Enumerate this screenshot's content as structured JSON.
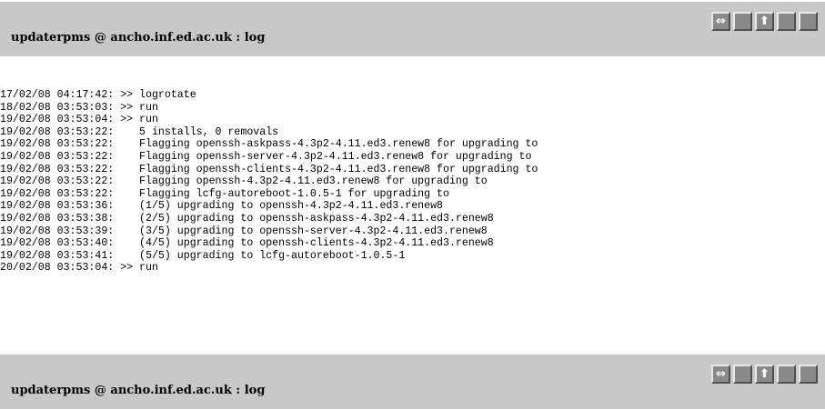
{
  "header": {
    "title": "updaterpms @ ancho.inf.ed.ac.uk : log"
  },
  "nav_buttons": [
    {
      "name": "double-arrow-icon",
      "glyph": "⇔"
    },
    {
      "name": "blank-button-icon",
      "glyph": ""
    },
    {
      "name": "up-arrow-icon",
      "glyph": "⬆"
    },
    {
      "name": "blank-button-icon",
      "glyph": ""
    },
    {
      "name": "blank-button-icon",
      "glyph": ""
    }
  ],
  "log": {
    "lines": [
      "17/02/08 04:17:42: >> logrotate",
      "18/02/08 03:53:03: >> run",
      "19/02/08 03:53:04: >> run",
      "19/02/08 03:53:22:    5 installs, 0 removals",
      "19/02/08 03:53:22:    Flagging openssh-askpass-4.3p2-4.11.ed3.renew8 for upgrading to",
      "19/02/08 03:53:22:    Flagging openssh-server-4.3p2-4.11.ed3.renew8 for upgrading to",
      "19/02/08 03:53:22:    Flagging openssh-clients-4.3p2-4.11.ed3.renew8 for upgrading to",
      "19/02/08 03:53:22:    Flagging openssh-4.3p2-4.11.ed3.renew8 for upgrading to",
      "19/02/08 03:53:22:    Flagging lcfg-autoreboot-1.0.5-1 for upgrading to",
      "19/02/08 03:53:36:    (1/5) upgrading to openssh-4.3p2-4.11.ed3.renew8",
      "19/02/08 03:53:38:    (2/5) upgrading to openssh-askpass-4.3p2-4.11.ed3.renew8",
      "19/02/08 03:53:39:    (3/5) upgrading to openssh-server-4.3p2-4.11.ed3.renew8",
      "19/02/08 03:53:40:    (4/5) upgrading to openssh-clients-4.3p2-4.11.ed3.renew8",
      "19/02/08 03:53:41:    (5/5) upgrading to lcfg-autoreboot-1.0.5-1",
      "20/02/08 03:53:04: >> run"
    ]
  },
  "colors": {
    "header_bg": "#c8c8c8",
    "button_bg": "#8a8a8a"
  }
}
